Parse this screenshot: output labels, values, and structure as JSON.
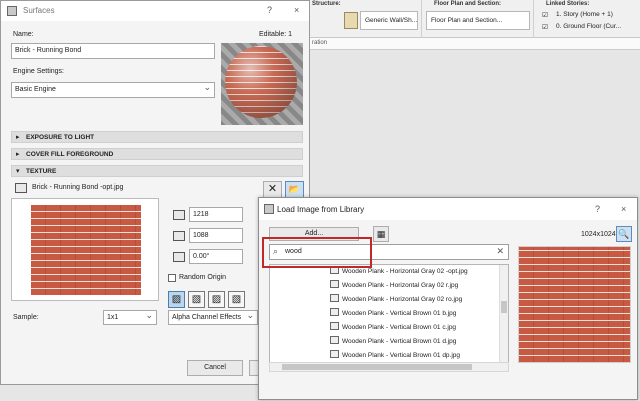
{
  "toolbar": {
    "structure_title": "Structure:",
    "structure_value": "Generic Wall/Sh...",
    "floorplan_title": "Floor Plan and Section:",
    "floorplan_value": "Floor Plan and Section...",
    "linked_title": "Linked Stories:",
    "linked_top": "1. Story (Home + 1)",
    "linked_bottom": "0. Ground Floor (Cur...",
    "strip_text": "ration"
  },
  "surfaces": {
    "title": "Surfaces",
    "help": "?",
    "close": "×",
    "name_label": "Name:",
    "editable_label": "Editable: 1",
    "name_value": "Brick - Running Bond",
    "engine_label": "Engine Settings:",
    "engine_value": "Basic Engine",
    "sections": [
      "EXPOSURE TO LIGHT",
      "COVER FILL FOREGROUND",
      "TEXTURE"
    ],
    "texture_name": "Brick - Running Bond -opt.jpg",
    "width": "1218",
    "height": "1088",
    "angle": "0.00°",
    "random_origin": "Random Origin",
    "sample_label": "Sample:",
    "sample_value": "1x1",
    "alpha_value": "Alpha Channel Effects",
    "cancel": "Cancel"
  },
  "load": {
    "title": "Load Image from Library",
    "help": "?",
    "close": "×",
    "add_button": "Add...",
    "size_label": "1024x1024",
    "search_value": "wood",
    "items": [
      "Wooden Plank - Horizontal Gray 02 -opt.jpg",
      "Wooden Plank - Horizontal Gray 02 r.jpg",
      "Wooden Plank - Horizontal Gray 02 ro.jpg",
      "Wooden Plank - Vertical Brown 01 b.jpg",
      "Wooden Plank - Vertical Brown 01 c.jpg",
      "Wooden Plank - Vertical Brown 01 d.jpg",
      "Wooden Plank - Vertical Brown 01 dp.jpg"
    ]
  }
}
